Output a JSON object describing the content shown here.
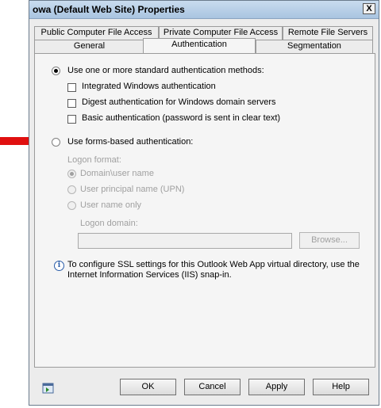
{
  "window": {
    "title": "owa (Default Web Site) Properties",
    "close_glyph": "X"
  },
  "tabs": {
    "row_back": [
      {
        "label": "Public Computer File Access"
      },
      {
        "label": "Private Computer File Access"
      },
      {
        "label": "Remote File Servers"
      }
    ],
    "row_front": [
      {
        "label": "General"
      },
      {
        "label": "Authentication",
        "selected": true
      },
      {
        "label": "Segmentation"
      }
    ]
  },
  "auth": {
    "standard_label": "Use one or more standard authentication methods:",
    "standard_selected": true,
    "integrated": {
      "label": "Integrated Windows authentication",
      "checked": false
    },
    "digest": {
      "label": "Digest authentication for Windows domain servers",
      "checked": false
    },
    "basic": {
      "label": "Basic authentication (password is sent in clear text)",
      "checked": false
    },
    "forms_label": "Use forms-based authentication:",
    "forms_selected": false,
    "logon_format_label": "Logon format:",
    "formats": [
      {
        "label": "Domain\\user name",
        "selected": true
      },
      {
        "label": "User principal name (UPN)",
        "selected": false
      },
      {
        "label": "User name only",
        "selected": false
      }
    ],
    "logon_domain_label": "Logon domain:",
    "logon_domain_value": "",
    "browse_label": "Browse..."
  },
  "info": {
    "text_line1": "To configure SSL settings for this Outlook Web App virtual directory, use the",
    "text_line2": "Internet Information Services (IIS) snap-in."
  },
  "footer": {
    "ok_label": "OK",
    "cancel_label": "Cancel",
    "apply_label": "Apply",
    "help_label": "Help"
  },
  "colors": {
    "annotation_arrow": "#e01010",
    "title_bar": "#b8cfe8"
  }
}
